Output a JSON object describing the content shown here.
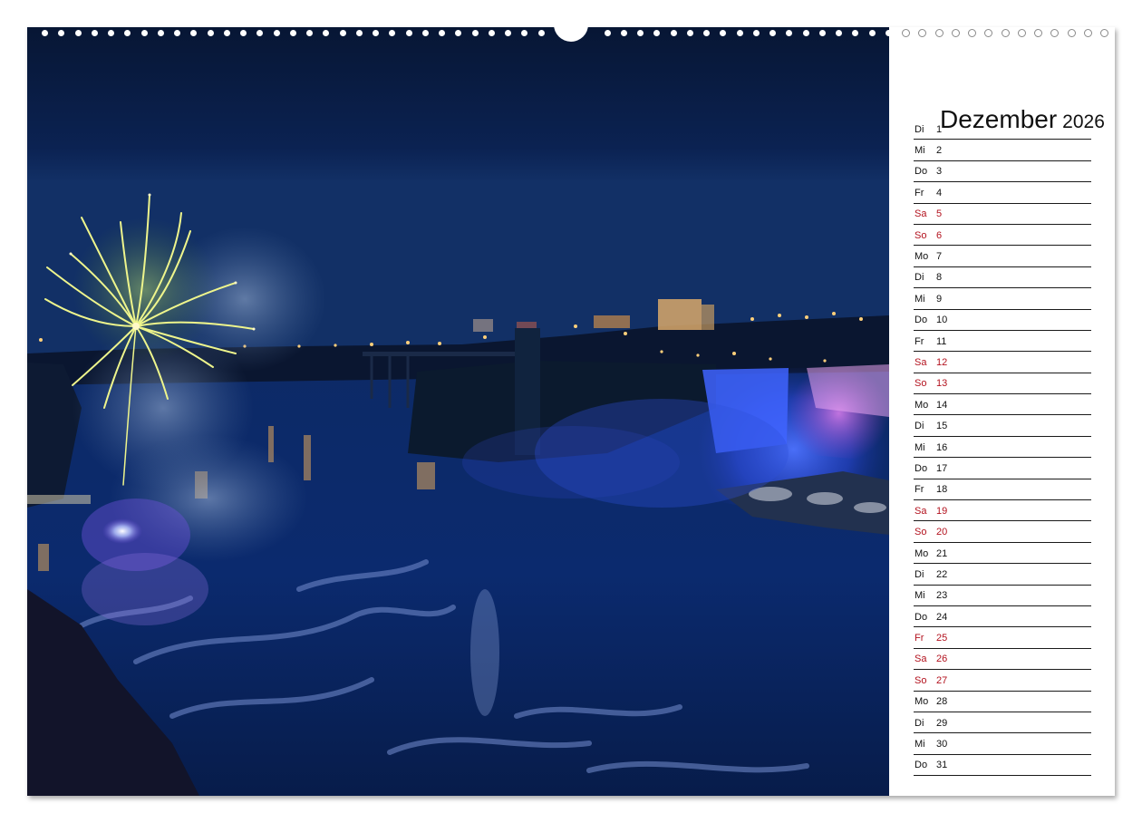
{
  "calendar": {
    "month": "Dezember",
    "year": "2026",
    "days": [
      {
        "dow": "Di",
        "day": "1",
        "holiday": false
      },
      {
        "dow": "Mi",
        "day": "2",
        "holiday": false
      },
      {
        "dow": "Do",
        "day": "3",
        "holiday": false
      },
      {
        "dow": "Fr",
        "day": "4",
        "holiday": false
      },
      {
        "dow": "Sa",
        "day": "5",
        "holiday": true
      },
      {
        "dow": "So",
        "day": "6",
        "holiday": true
      },
      {
        "dow": "Mo",
        "day": "7",
        "holiday": false
      },
      {
        "dow": "Di",
        "day": "8",
        "holiday": false
      },
      {
        "dow": "Mi",
        "day": "9",
        "holiday": false
      },
      {
        "dow": "Do",
        "day": "10",
        "holiday": false
      },
      {
        "dow": "Fr",
        "day": "11",
        "holiday": false
      },
      {
        "dow": "Sa",
        "day": "12",
        "holiday": true
      },
      {
        "dow": "So",
        "day": "13",
        "holiday": true
      },
      {
        "dow": "Mo",
        "day": "14",
        "holiday": false
      },
      {
        "dow": "Di",
        "day": "15",
        "holiday": false
      },
      {
        "dow": "Mi",
        "day": "16",
        "holiday": false
      },
      {
        "dow": "Do",
        "day": "17",
        "holiday": false
      },
      {
        "dow": "Fr",
        "day": "18",
        "holiday": false
      },
      {
        "dow": "Sa",
        "day": "19",
        "holiday": true
      },
      {
        "dow": "So",
        "day": "20",
        "holiday": true
      },
      {
        "dow": "Mo",
        "day": "21",
        "holiday": false
      },
      {
        "dow": "Di",
        "day": "22",
        "holiday": false
      },
      {
        "dow": "Mi",
        "day": "23",
        "holiday": false
      },
      {
        "dow": "Do",
        "day": "24",
        "holiday": false
      },
      {
        "dow": "Fr",
        "day": "25",
        "holiday": true
      },
      {
        "dow": "Sa",
        "day": "26",
        "holiday": true
      },
      {
        "dow": "So",
        "day": "27",
        "holiday": true
      },
      {
        "dow": "Mo",
        "day": "28",
        "holiday": false
      },
      {
        "dow": "Di",
        "day": "29",
        "holiday": false
      },
      {
        "dow": "Mi",
        "day": "30",
        "holiday": false
      },
      {
        "dow": "Do",
        "day": "31",
        "holiday": false
      }
    ]
  },
  "colors": {
    "weekday_text": "#111111",
    "holiday_text": "#b3121e",
    "sky": "#0b1d4a",
    "water": "#0c2a63",
    "falls_glow": "#3a5cff",
    "falls_pink": "#c46ad8",
    "firework": "#e8f08a"
  }
}
